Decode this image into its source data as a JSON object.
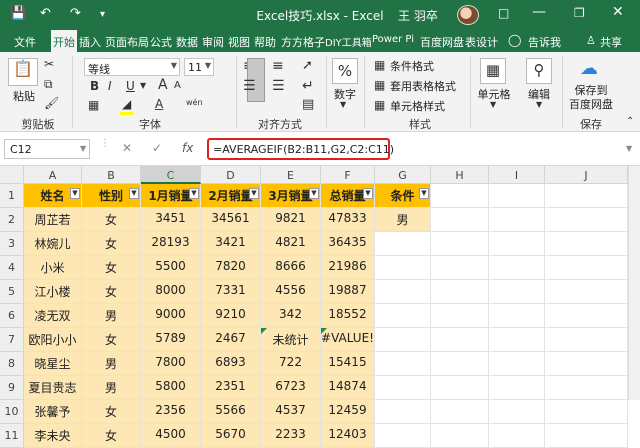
{
  "window": {
    "title": "Excel技巧.xlsx  -  Excel",
    "user": "王 羽卒",
    "quick_access": [
      "save-icon",
      "undo-icon",
      "redo-icon",
      "quick-access-more-icon"
    ],
    "controls": [
      "ribbon-display-icon",
      "minimize-icon",
      "restore-icon",
      "close-icon"
    ]
  },
  "tabs": [
    "文件",
    "开始",
    "插入",
    "页面布局",
    "公式",
    "数据",
    "审阅",
    "视图",
    "帮助",
    "方方格子",
    "DIY工具箱",
    "Power Pi",
    "百度网盘",
    "表设计"
  ],
  "active_tab": "开始",
  "tell_me": "告诉我",
  "share": "共享",
  "ribbon": {
    "clipboard": {
      "paste": "粘贴",
      "label": "剪贴板"
    },
    "font": {
      "name": "等线",
      "size": "11",
      "label": "字体",
      "bold": "B",
      "italic": "I",
      "underline": "U",
      "grow": "A",
      "shrink": "A",
      "wen": "wén"
    },
    "alignment": {
      "label": "对齐方式"
    },
    "number": {
      "button": "数字",
      "symbol": "%"
    },
    "styles": {
      "label": "样式",
      "items": [
        "条件格式",
        "套用表格格式",
        "单元格样式"
      ]
    },
    "cells": {
      "button": "单元格"
    },
    "editing": {
      "button": "编辑"
    },
    "save": {
      "button_line1": "保存到",
      "button_line2": "百度网盘",
      "label": "保存"
    }
  },
  "formula_bar": {
    "name_box": "C12",
    "formula": "=AVERAGEIF(B2:B11,G2,C2:C11)",
    "fx": "fx"
  },
  "sheet": {
    "columns": [
      "A",
      "B",
      "C",
      "D",
      "E",
      "F",
      "G",
      "H",
      "I",
      "J"
    ],
    "selected_column": "C",
    "row_numbers": [
      "1",
      "2",
      "3",
      "4",
      "5",
      "6",
      "7",
      "8",
      "9",
      "10",
      "11"
    ],
    "headers": [
      "姓名",
      "性别",
      "1月销量",
      "2月销量",
      "3月销量",
      "总销量",
      "条件"
    ],
    "rows": [
      [
        "周芷若",
        "女",
        "3451",
        "34561",
        "9821",
        "47833",
        "男"
      ],
      [
        "林婉儿",
        "女",
        "28193",
        "3421",
        "4821",
        "36435",
        ""
      ],
      [
        "小米",
        "女",
        "5500",
        "7820",
        "8666",
        "21986",
        ""
      ],
      [
        "江小楼",
        "女",
        "8000",
        "7331",
        "4556",
        "19887",
        ""
      ],
      [
        "凌无双",
        "男",
        "9000",
        "9210",
        "342",
        "18552",
        ""
      ],
      [
        "欧阳小小",
        "女",
        "5789",
        "2467",
        "未统计",
        "#VALUE!",
        ""
      ],
      [
        "晓星尘",
        "男",
        "7800",
        "6893",
        "722",
        "15415",
        ""
      ],
      [
        "夏目贵志",
        "男",
        "5800",
        "2351",
        "6723",
        "14874",
        ""
      ],
      [
        "张馨予",
        "女",
        "2356",
        "5566",
        "4537",
        "12459",
        ""
      ],
      [
        "李未央",
        "女",
        "4500",
        "5670",
        "2233",
        "12403",
        ""
      ]
    ],
    "colors": {
      "header": "#ffc000",
      "band": "#fde7b4",
      "excel_green": "#217346",
      "highlight_border": "#e0201c"
    }
  }
}
